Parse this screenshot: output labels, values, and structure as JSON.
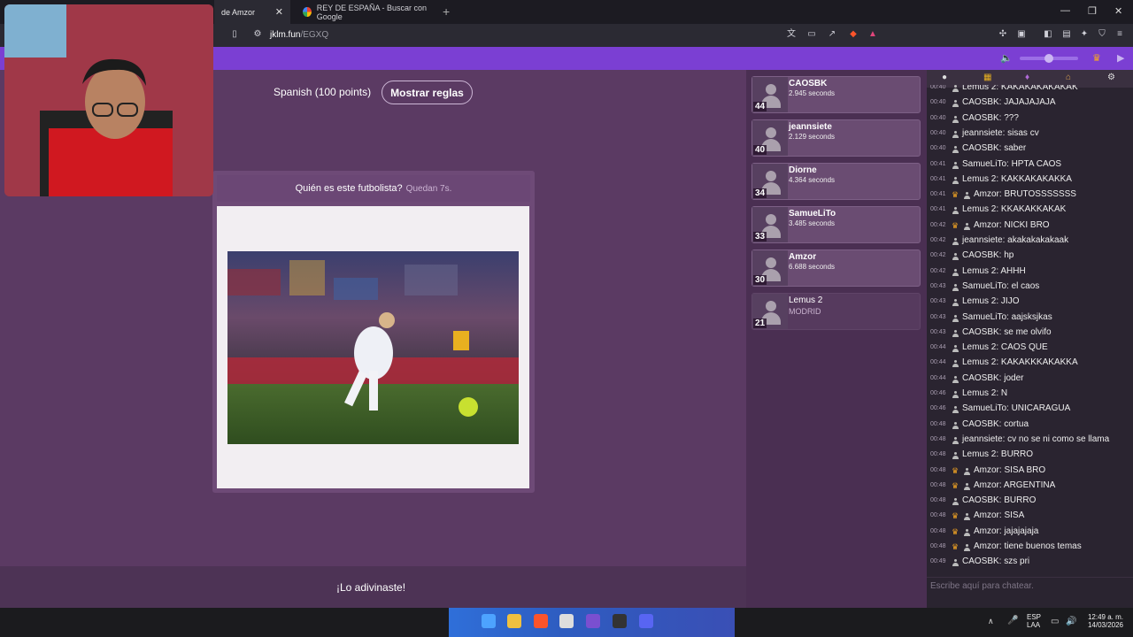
{
  "browser": {
    "tabs": [
      {
        "label": "de Amzor"
      },
      {
        "label": "REY DE ESPAÑA - Buscar con Google"
      }
    ],
    "url_host": "jklm.fun",
    "url_path": "/EGXQ"
  },
  "game": {
    "mode": "Spanish (100 points)",
    "rules_button": "Mostrar reglas",
    "question": "Quién es este futbolista?",
    "timer": "Quedan 7s.",
    "result": "¡Lo adivinaste!"
  },
  "scoreboard": [
    {
      "name": "CAOSBK",
      "detail": "2.945 seconds",
      "points": "44"
    },
    {
      "name": "jeannsiete",
      "detail": "2.129 seconds",
      "points": "40"
    },
    {
      "name": "Diorne",
      "detail": "4.364 seconds",
      "points": "34"
    },
    {
      "name": "SamueLiTo",
      "detail": "3.485 seconds",
      "points": "33"
    },
    {
      "name": "Amzor",
      "detail": "6.688 seconds",
      "points": "30"
    },
    {
      "name": "Lemus 2",
      "detail": "MODRID",
      "points": "21"
    }
  ],
  "chat": {
    "messages": [
      {
        "time": "00:40",
        "crown": false,
        "text": "Lemus 2: KAKAKAKAKAKAK"
      },
      {
        "time": "00:40",
        "crown": false,
        "text": "CAOSBK: JAJAJAJAJA"
      },
      {
        "time": "00:40",
        "crown": false,
        "text": "CAOSBK: ???"
      },
      {
        "time": "00:40",
        "crown": false,
        "text": "jeannsiete: sisas cv"
      },
      {
        "time": "00:40",
        "crown": false,
        "text": "CAOSBK: saber"
      },
      {
        "time": "00:41",
        "crown": false,
        "text": "SamueLiTo: HPTA CAOS"
      },
      {
        "time": "00:41",
        "crown": false,
        "text": "Lemus 2: KAKKAKAKAKKA"
      },
      {
        "time": "00:41",
        "crown": true,
        "text": "Amzor: BRUTOSSSSSSS"
      },
      {
        "time": "00:41",
        "crown": false,
        "text": "Lemus 2: KKAKAKKAKAK"
      },
      {
        "time": "00:42",
        "crown": true,
        "text": "Amzor: NICKI BRO"
      },
      {
        "time": "00:42",
        "crown": false,
        "text": "jeannsiete: akakakakakaak"
      },
      {
        "time": "00:42",
        "crown": false,
        "text": "CAOSBK: hp"
      },
      {
        "time": "00:42",
        "crown": false,
        "text": "Lemus 2: AHHH"
      },
      {
        "time": "00:43",
        "crown": false,
        "text": "SamueLiTo: el caos"
      },
      {
        "time": "00:43",
        "crown": false,
        "text": "Lemus 2: JIJO"
      },
      {
        "time": "00:43",
        "crown": false,
        "text": "SamueLiTo: aajsksjkas"
      },
      {
        "time": "00:43",
        "crown": false,
        "text": "CAOSBK: se me olvifo"
      },
      {
        "time": "00:44",
        "crown": false,
        "text": "Lemus 2: CAOS QUE"
      },
      {
        "time": "00:44",
        "crown": false,
        "text": "Lemus 2: KAKAKKKAKAKKA"
      },
      {
        "time": "00:44",
        "crown": false,
        "text": "CAOSBK: joder"
      },
      {
        "time": "00:46",
        "crown": false,
        "text": "Lemus 2: N"
      },
      {
        "time": "00:46",
        "crown": false,
        "text": "SamueLiTo: UNICARAGUA"
      },
      {
        "time": "00:48",
        "crown": false,
        "text": "CAOSBK: cortua"
      },
      {
        "time": "00:48",
        "crown": false,
        "text": "jeannsiete: cv no se ni como se llama"
      },
      {
        "time": "00:48",
        "crown": false,
        "text": "Lemus 2: BURRO"
      },
      {
        "time": "00:48",
        "crown": true,
        "text": "Amzor: SISA BRO"
      },
      {
        "time": "00:48",
        "crown": true,
        "text": "Amzor: ARGENTINA"
      },
      {
        "time": "00:48",
        "crown": false,
        "text": "CAOSBK: BURRO"
      },
      {
        "time": "00:48",
        "crown": true,
        "text": "Amzor: SISA"
      },
      {
        "time": "00:48",
        "crown": true,
        "text": "Amzor: jajajajaja"
      },
      {
        "time": "00:48",
        "crown": true,
        "text": "Amzor: tiene buenos temas"
      },
      {
        "time": "00:49",
        "crown": false,
        "text": "CAOSBK: szs pri"
      }
    ],
    "input_placeholder": "Escribe aquí para chatear."
  },
  "system": {
    "lang": "ESP",
    "layout": "LAA",
    "time": "12:49 a. m.",
    "date": "14/03/2026"
  },
  "colors": {
    "accent": "#7b3fd3",
    "game_bg": "#5b3a63",
    "chat_bg": "#2a2430"
  }
}
